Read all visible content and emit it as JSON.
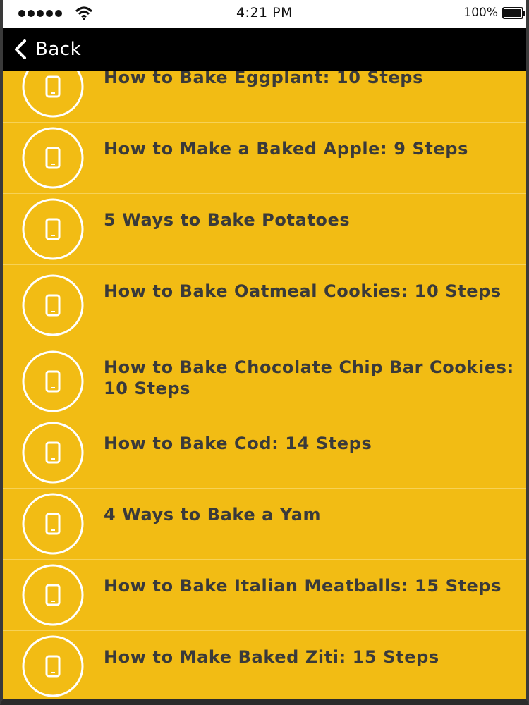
{
  "status_bar": {
    "time": "4:21 PM",
    "battery_percent": "100%"
  },
  "nav": {
    "back_label": "Back"
  },
  "list": {
    "items": [
      {
        "label": "How to Bake Eggplant: 10 Steps"
      },
      {
        "label": "How to Make a Baked Apple: 9 Steps"
      },
      {
        "label": "5 Ways to Bake Potatoes"
      },
      {
        "label": "How to Bake Oatmeal Cookies: 10 Steps"
      },
      {
        "label": "How to Bake Chocolate Chip Bar Cookies: 10 Steps"
      },
      {
        "label": "How to Bake Cod: 14 Steps"
      },
      {
        "label": "4 Ways to Bake a Yam"
      },
      {
        "label": "How to Bake Italian Meatballs: 15 Steps"
      },
      {
        "label": "How to Make Baked Ziti: 15 Steps"
      }
    ]
  },
  "colors": {
    "list_background": "#f2bc14",
    "nav_background": "#000000",
    "text": "#3a3a3a",
    "icon": "#ffffff"
  },
  "icons": {
    "item_icon": "phone-icon",
    "back_icon": "chevron-left-icon"
  }
}
